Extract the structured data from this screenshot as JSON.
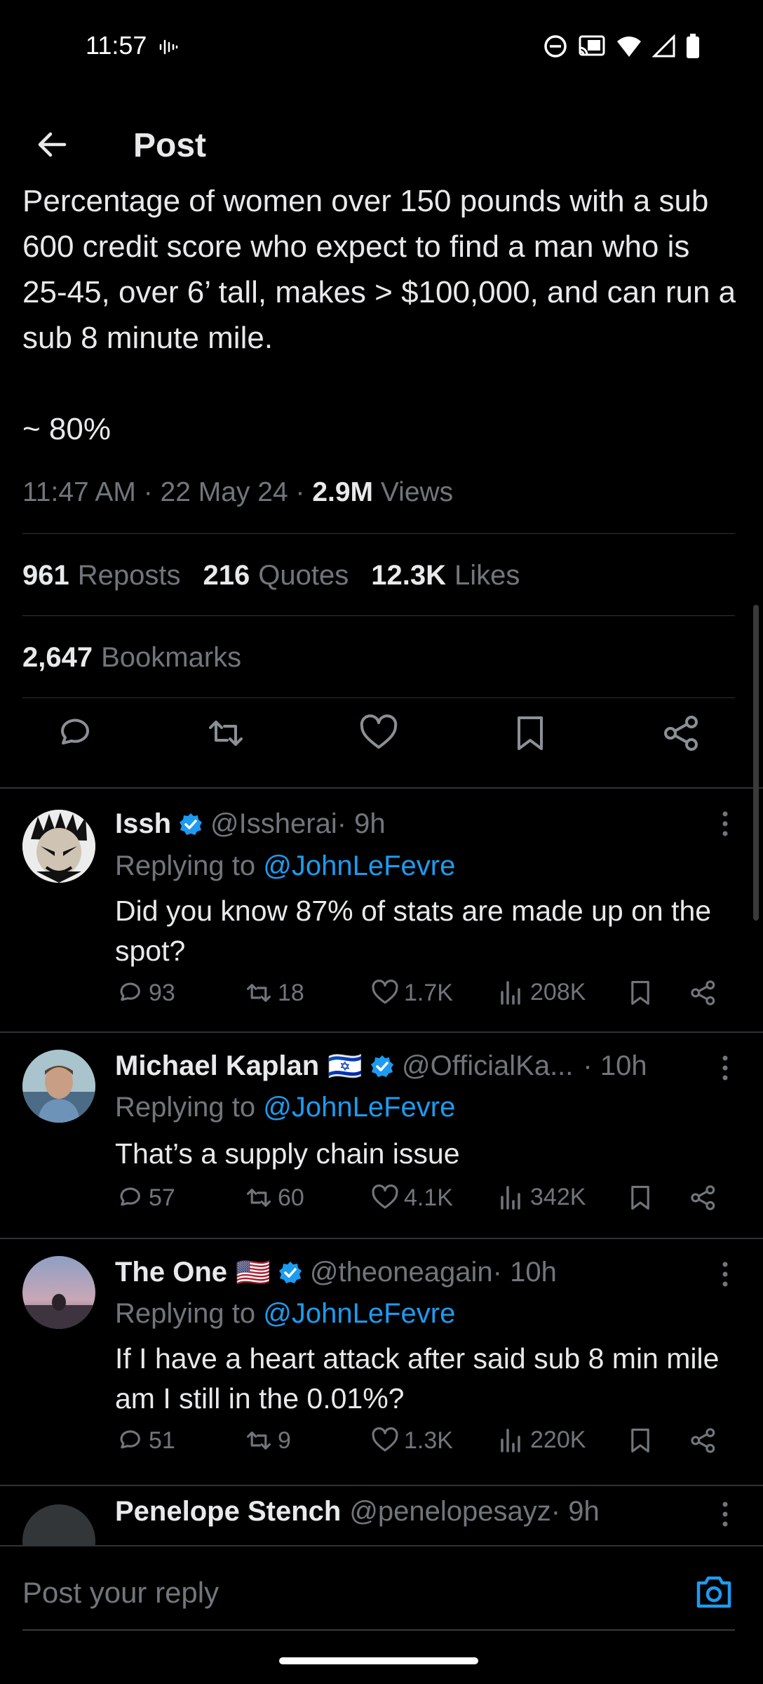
{
  "status_bar": {
    "time": "11:57"
  },
  "header": {
    "title": "Post"
  },
  "post": {
    "text": "Percentage of women over 150 pounds with a sub 600 credit score who expect to find a man who is 25-45, over 6’ tall, makes > $100,000, and can run a sub 8 minute mile.\n\n~ 80%",
    "timestamp": "11:47 AM · 22 May 24 · ",
    "views_count": "2.9M",
    "views_label": " Views",
    "reposts_count": "961",
    "reposts_label": "Reposts",
    "quotes_count": "216",
    "quotes_label": "Quotes",
    "likes_count": "12.3K",
    "likes_label": "Likes",
    "bookmarks_count": "2,647",
    "bookmarks_label": "Bookmarks"
  },
  "replies": [
    {
      "name": "Issh",
      "handle": "@Issherai",
      "time": " · 9h",
      "replying_prefix": "Replying to ",
      "replying_to": "@JohnLeFevre",
      "text": "Did you know 87% of stats are made up on the spot?",
      "replies": "93",
      "reposts": "18",
      "likes": "1.7K",
      "views": "208K"
    },
    {
      "name": "Michael Kaplan",
      "flag": "🇮🇱",
      "handle": "@OfficialKa...",
      "time": " · 10h",
      "replying_prefix": "Replying to ",
      "replying_to": "@JohnLeFevre",
      "text": "That’s a supply chain issue",
      "replies": "57",
      "reposts": "60",
      "likes": "4.1K",
      "views": "342K"
    },
    {
      "name": "The One",
      "flag": "🇺🇸",
      "handle": "@theoneagain",
      "time": " · 10h",
      "replying_prefix": "Replying to ",
      "replying_to": "@JohnLeFevre",
      "text": "If I have a heart attack after said sub 8 min mile am I still in the 0.01%?",
      "replies": "51",
      "reposts": "9",
      "likes": "1.3K",
      "views": "220K"
    },
    {
      "name": "Penelope Stench",
      "handle": "@penelopesayz",
      "time": " · 9h"
    }
  ],
  "reply_bar": {
    "placeholder": "Post your reply"
  },
  "colors": {
    "background": "#000000",
    "text": "#e7e9ea",
    "muted": "#71767b",
    "accent": "#1d9bf0",
    "divider": "#2f3336"
  }
}
